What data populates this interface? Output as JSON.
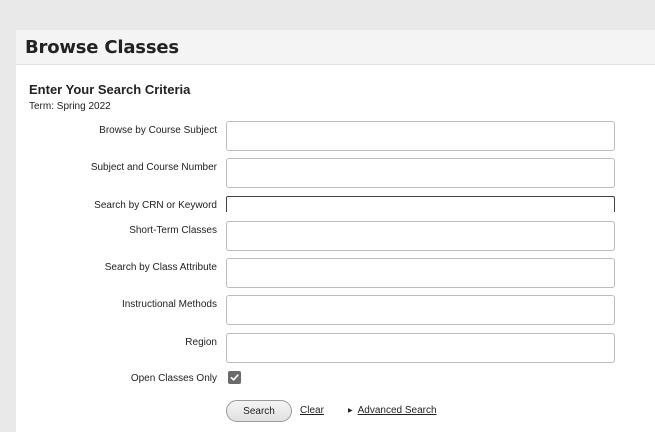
{
  "page": {
    "title": "Browse Classes"
  },
  "search": {
    "heading": "Enter Your Search Criteria",
    "term": "Term: Spring 2022",
    "fields": [
      {
        "label": "Browse by Course Subject",
        "value": ""
      },
      {
        "label": "Subject and Course Number",
        "value": ""
      },
      {
        "label": "Search by CRN or Keyword",
        "value": ""
      },
      {
        "label": "Short-Term Classes",
        "value": ""
      },
      {
        "label": "Search by Class Attribute",
        "value": ""
      },
      {
        "label": "Instructional Methods",
        "value": ""
      },
      {
        "label": "Region",
        "value": ""
      }
    ],
    "open_only_label": "Open Classes Only",
    "open_only_checked": true
  },
  "actions": {
    "search_label": "Search",
    "clear_label": "Clear",
    "advanced_label": "Advanced Search"
  },
  "icons": {
    "checkbox": "checkmark-icon",
    "disclosure": "triangle-right-icon"
  },
  "colors": {
    "checkbox_fill": "#6a6a6a",
    "header_bg": "#f4f4f4",
    "page_bg": "#e9e9e9"
  }
}
